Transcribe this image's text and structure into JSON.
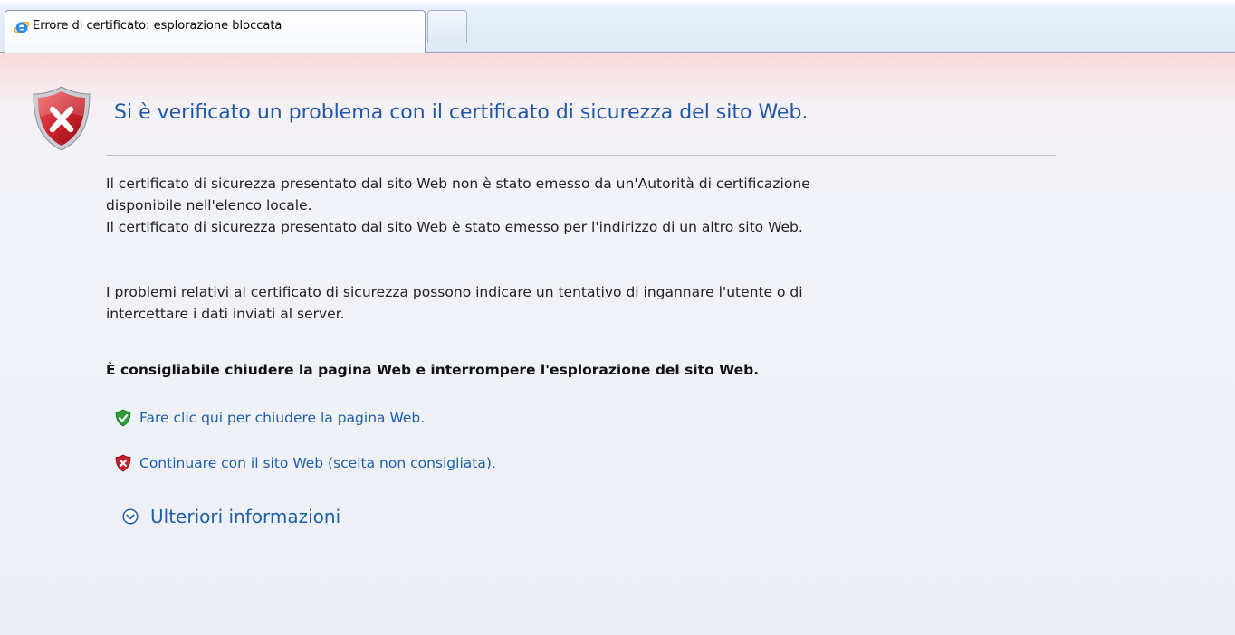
{
  "tab": {
    "title": "Errore di certificato: esplorazione bloccata",
    "icon": "internet-explorer-icon"
  },
  "content": {
    "headline": "Si è verificato un problema con il certificato di sicurezza del sito Web.",
    "paragraph1": [
      "Il certificato di sicurezza presentato dal sito Web non è stato emesso da un'Autorità di certificazione",
      "disponibile nell'elenco locale.",
      "Il certificato di sicurezza presentato dal sito Web è stato emesso per l'indirizzo di un altro sito Web."
    ],
    "paragraph2": [
      "I problemi relativi al certificato di sicurezza possono indicare un tentativo di ingannare l'utente o di",
      "intercettare i dati inviati al server."
    ],
    "recommendation": "È consigliabile chiudere la pagina Web e interrompere l'esplorazione del sito Web.",
    "options": {
      "close_label": "Fare clic qui per chiudere la pagina Web.",
      "continue_label": "Continuare con il sito Web (scelta non consigliata)."
    },
    "more_info_label": "Ulteriori informazioni"
  },
  "icons": {
    "shield": "shield-error-icon",
    "close_option": "green-shield-check-icon",
    "continue_option": "red-shield-x-icon",
    "more_info": "chevron-down-circle-icon"
  },
  "colors": {
    "headline": "#1f57a8",
    "link": "#1e5fa8",
    "shield_red": "#c8202a",
    "shield_green": "#2f9a3a"
  }
}
